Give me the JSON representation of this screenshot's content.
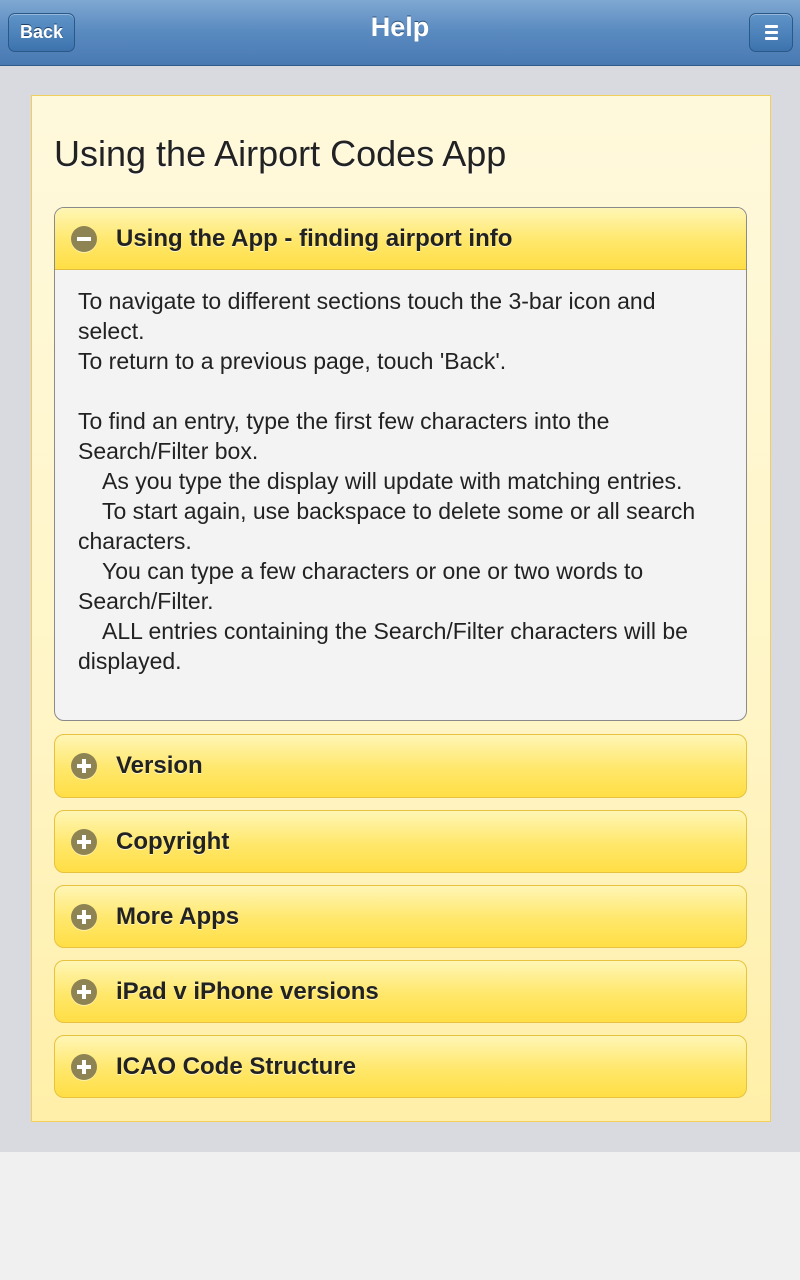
{
  "header": {
    "title": "Help",
    "back_label": "Back",
    "menu_icon": "menu-icon"
  },
  "page": {
    "title": "Using the Airport Codes App"
  },
  "sections": [
    {
      "label": "Using the App - finding airport info",
      "expanded": true,
      "icon": "minus-circle-icon",
      "body": {
        "p1": "To navigate to different sections touch the 3-bar icon and select.",
        "p2": "To return to a previous page, touch 'Back'.",
        "p3": "To find an entry, type the first few characters into the Search/Filter box.",
        "p4": "As you type the display will update with matching entries.",
        "p5": "To start again, use backspace to delete some or all search characters.",
        "p6": "You can type a few characters or one or two words to Search/Filter.",
        "p7": "ALL entries containing the Search/Filter characters will be displayed."
      }
    },
    {
      "label": "Version",
      "expanded": false,
      "icon": "plus-circle-icon"
    },
    {
      "label": "Copyright",
      "expanded": false,
      "icon": "plus-circle-icon"
    },
    {
      "label": "More Apps",
      "expanded": false,
      "icon": "plus-circle-icon"
    },
    {
      "label": "iPad v iPhone versions",
      "expanded": false,
      "icon": "plus-circle-icon"
    },
    {
      "label": "ICAO Code Structure",
      "expanded": false,
      "icon": "plus-circle-icon"
    }
  ],
  "colors": {
    "header": "#5889bf",
    "accordion": "#ffe76a",
    "panel": "#fff5c6"
  }
}
